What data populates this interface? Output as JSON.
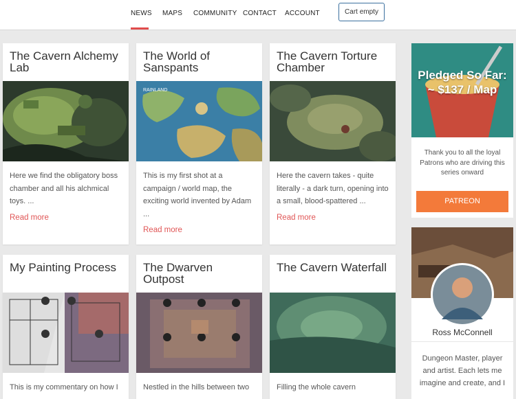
{
  "nav": {
    "items": [
      "NEWS",
      "MAPS",
      "COMMUNITY",
      "CONTACT",
      "ACCOUNT"
    ],
    "active": "NEWS",
    "cart_label": "Cart empty",
    "accent_color": "#e04b4b"
  },
  "posts": [
    {
      "title": "The Cavern Alchemy Lab",
      "excerpt": "Here we find the obligatory boss chamber and all his alchmical toys. ...",
      "read_more": "Read more"
    },
    {
      "title": "The World of Sanspants",
      "excerpt": "This is my first shot at a campaign / world map, the exciting world invented by Adam ...",
      "read_more": "Read more",
      "map_label": "RAINLAND"
    },
    {
      "title": "The Cavern Torture Chamber",
      "excerpt": "Here the cavern takes - quite literally - a dark turn, opening into a small, blood-spattered ...",
      "read_more": "Read more"
    },
    {
      "title": "My Painting Process",
      "excerpt": "This is my commentary on how I"
    },
    {
      "title": "The Dwarven Outpost",
      "excerpt": "Nestled in the hills between two"
    },
    {
      "title": "The Cavern Waterfall",
      "excerpt": "Filling the whole cavern"
    }
  ],
  "sidebar": {
    "pledge_text": "Pledged So Far: ~ $137 / Map",
    "thanks_text": "Thank you to all the loyal Patrons who are driving this series onward",
    "patreon_label": "PATREON",
    "patreon_color": "#f37a3a",
    "author_name": "Ross McConnell",
    "author_bio": "Dungeon Master, player and artist. Each lets me imagine and create, and I"
  }
}
